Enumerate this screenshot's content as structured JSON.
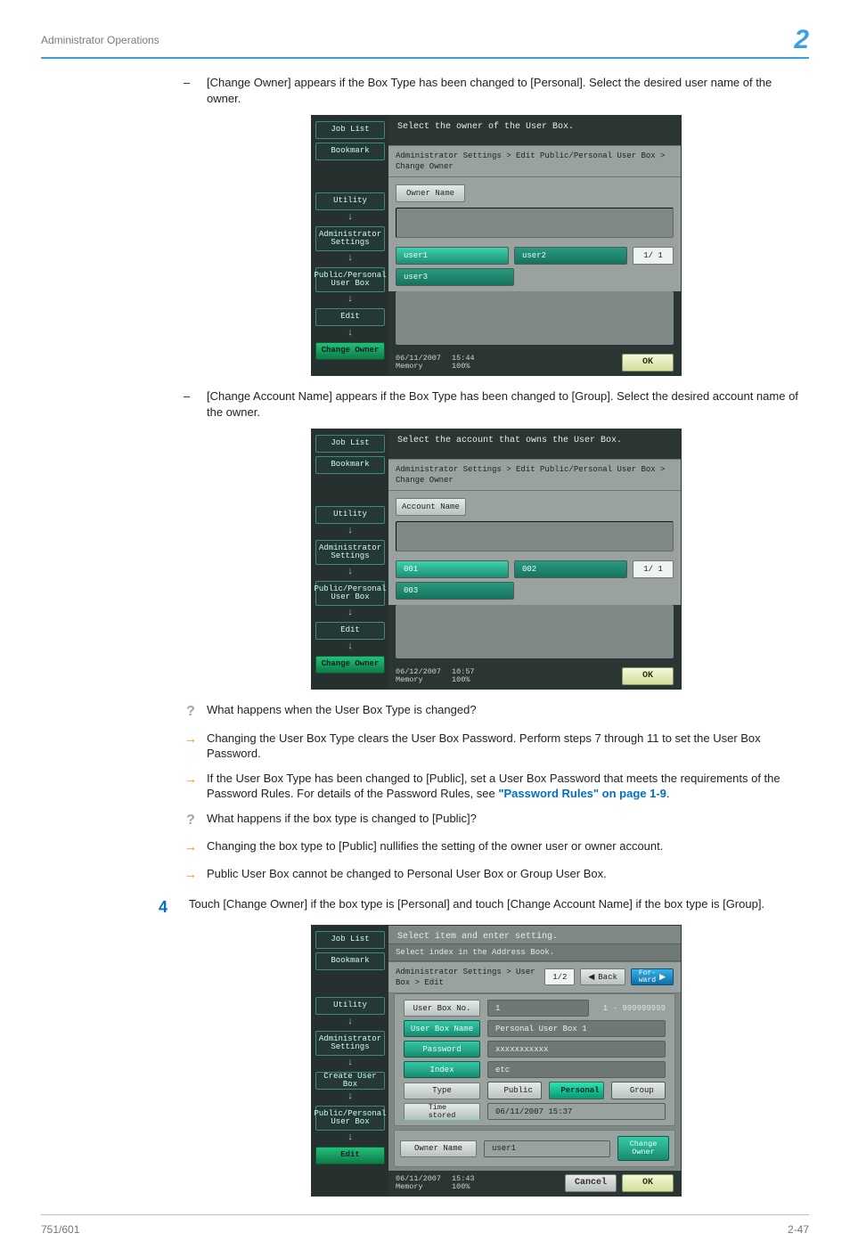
{
  "header": {
    "title": "Administrator Operations",
    "chapter": "2"
  },
  "footer": {
    "left": "751/601",
    "right": "2-47"
  },
  "intro1": "[Change Owner] appears if the Box Type has been changed to [Personal]. Select the desired user name of the owner.",
  "intro2": "[Change Account Name] appears if the Box Type has been changed to [Group]. Select the desired account name of the owner.",
  "panel1": {
    "side": [
      "Job List",
      "Bookmark",
      "Utility",
      "Administrator Settings",
      "Public/Personal User Box",
      "Edit",
      "Change Owner"
    ],
    "header": "Select the owner of the User Box.",
    "breadcrumb": "Administrator Settings > Edit Public/Personal User Box > Change Owner",
    "field_label": "Owner Name",
    "options": [
      "user1",
      "user2",
      "user3"
    ],
    "pager": "1/   1",
    "date": "06/11/2007",
    "time": "15:44",
    "memory": "Memory",
    "mempct": "100%",
    "ok": "OK"
  },
  "panel2": {
    "side": [
      "Job List",
      "Bookmark",
      "Utility",
      "Administrator Settings",
      "Public/Personal User Box",
      "Edit",
      "Change Owner"
    ],
    "header": "Select the account that owns the User Box.",
    "breadcrumb": "Administrator Settings > Edit Public/Personal User Box > Change Owner",
    "field_label": "Account Name",
    "options": [
      "001",
      "002",
      "003"
    ],
    "pager": "1/   1",
    "date": "06/12/2007",
    "time": "10:57",
    "memory": "Memory",
    "mempct": "100%",
    "ok": "OK"
  },
  "qa": {
    "q1": "What happens when the User Box Type is changed?",
    "a1": "Changing the User Box Type clears the User Box Password. Perform steps 7 through 11 to set the User Box Password.",
    "a2a": "If the User Box Type has been changed to [Public], set a User Box Password that meets the requirements of the Password Rules. For details of the Password Rules, see ",
    "a2link": "\"Password Rules\" on page 1-9",
    "a2b": ".",
    "q2": "What happens if the box type is changed to [Public]?",
    "a3": "Changing the box type to [Public] nullifies the setting of the owner user or owner account.",
    "a4": "Public User Box cannot be changed to Personal User Box or Group User Box."
  },
  "step4": {
    "num": "4",
    "text": "Touch [Change Owner] if the box type is [Personal] and touch [Change Account Name] if the box type is [Group]."
  },
  "panel3": {
    "side": [
      "Job List",
      "Bookmark",
      "Utility",
      "Administrator Settings",
      "Create User Box",
      "Public/Personal User Box",
      "Edit"
    ],
    "header1": "Select item and enter setting.",
    "header2": "Select index in the Address Book.",
    "breadcrumb": "Administrator Settings > User Box > Edit",
    "page": "1/2",
    "back": "Back",
    "fwd": "For-\nward",
    "rows": {
      "userboxno": {
        "label": "User Box No.",
        "value": "1",
        "range": "1 - 999999999"
      },
      "userboxname": {
        "label": "User Box Name",
        "value": "Personal User Box 1"
      },
      "password": {
        "label": "Password",
        "value": "xxxxxxxxxxx"
      },
      "index": {
        "label": "Index",
        "value": "etc"
      },
      "type": {
        "label": "Type",
        "opts": [
          "Public",
          "Personal",
          "Group"
        ],
        "selected": 1
      },
      "time": {
        "label": "Time\nstored",
        "value": "06/11/2007   15:37"
      },
      "owner": {
        "label": "Owner Name",
        "value": "user1",
        "change": "Change\nOwner"
      }
    },
    "date": "06/11/2007",
    "time2": "15:43",
    "memory": "Memory",
    "mempct": "100%",
    "cancel": "Cancel",
    "ok": "OK"
  }
}
